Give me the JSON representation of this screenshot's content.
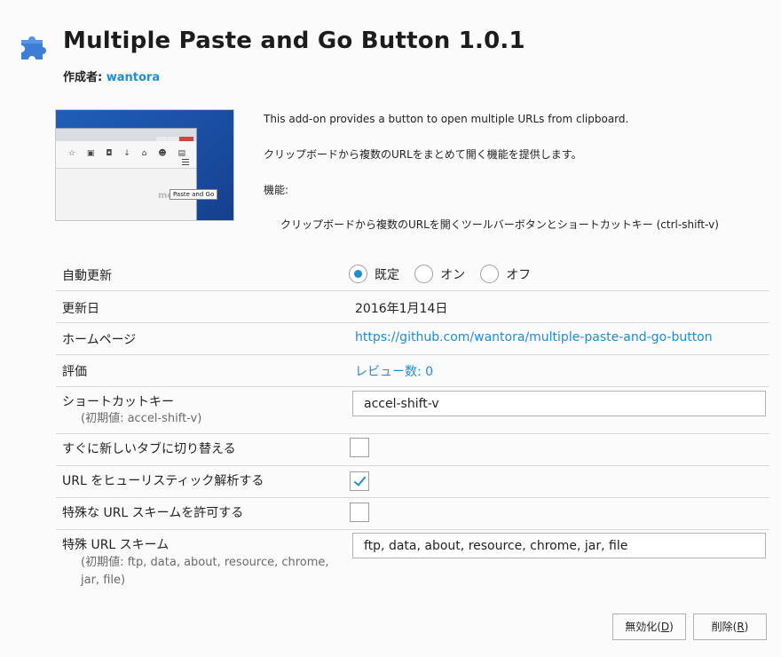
{
  "addon": {
    "title": "Multiple Paste and Go Button 1.0.1",
    "author_label": "作成者:",
    "author_name": "wantora"
  },
  "screenshot": {
    "tooltip": "Paste and Go",
    "faded_text": "mo"
  },
  "description": {
    "line1": "This add-on provides a button to open multiple URLs from clipboard.",
    "line2": "クリップボードから複数のURLをまとめて開く機能を提供します。",
    "line3": "機能:",
    "line4": "クリップボードから複数のURLを開くツールバーボタンとショートカットキー (ctrl-shift-v)"
  },
  "details": {
    "auto_update": {
      "label": "自動更新",
      "options": [
        "既定",
        "オン",
        "オフ"
      ],
      "selected": "既定"
    },
    "updated": {
      "label": "更新日",
      "value": "2016年1月14日"
    },
    "homepage": {
      "label": "ホームページ",
      "value": "https://github.com/wantora/multiple-paste-and-go-button"
    },
    "rating": {
      "label": "評価",
      "value": "レビュー数: 0"
    },
    "shortcut": {
      "label": "ショートカットキー",
      "hint": "(初期値: accel-shift-v)",
      "value": "accel-shift-v"
    },
    "switch_tab": {
      "label": "すぐに新しいタブに切り替える",
      "checked": false
    },
    "heuristic": {
      "label": "URL をヒューリスティック解析する",
      "checked": true
    },
    "allow_schemes": {
      "label": "特殊な URL スキームを許可する",
      "checked": false
    },
    "schemes": {
      "label": "特殊 URL スキーム",
      "hint_line1": "(初期値: ftp, data, about, resource, chrome,",
      "hint_line2": "jar, file)",
      "value": "ftp, data, about, resource, chrome, jar, file"
    }
  },
  "buttons": {
    "disable": {
      "text": "無効化(",
      "key": "D",
      "end": ")"
    },
    "remove": {
      "text": "削除(",
      "key": "R",
      "end": ")"
    }
  },
  "colors": {
    "accent": "#1e8ed1",
    "puzzle": "#3d7fd6"
  }
}
